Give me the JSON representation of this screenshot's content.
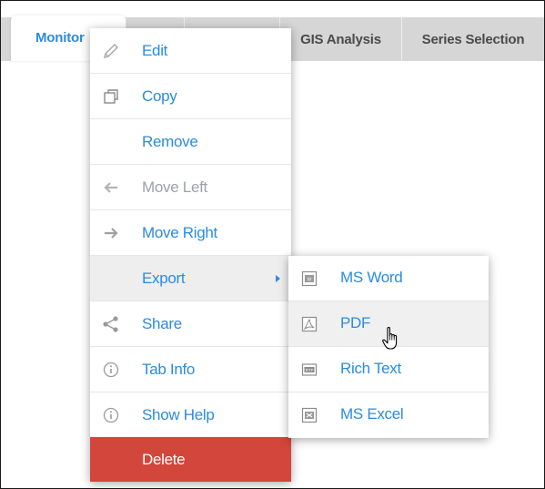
{
  "tabs": [
    {
      "label": "Monitor",
      "active": true
    },
    {
      "label": "",
      "active": false
    },
    {
      "label": "",
      "active": false
    },
    {
      "label": "GIS Analysis",
      "active": false
    },
    {
      "label": "Series Selection",
      "active": false
    }
  ],
  "context_menu": {
    "items": [
      {
        "label": "Edit",
        "icon": "pencil-icon",
        "state": "enabled"
      },
      {
        "label": "Copy",
        "icon": "copy-icon",
        "state": "enabled"
      },
      {
        "label": "Remove",
        "icon": "",
        "state": "enabled"
      },
      {
        "label": "Move Left",
        "icon": "arrow-left-icon",
        "state": "disabled"
      },
      {
        "label": "Move Right",
        "icon": "arrow-right-icon",
        "state": "enabled"
      },
      {
        "label": "Export",
        "icon": "",
        "state": "hover",
        "has_submenu": true
      },
      {
        "label": "Share",
        "icon": "share-icon",
        "state": "enabled"
      },
      {
        "label": "Tab Info",
        "icon": "info-icon",
        "state": "enabled"
      },
      {
        "label": "Show Help",
        "icon": "info-icon",
        "state": "enabled"
      },
      {
        "label": "Delete",
        "icon": "",
        "state": "danger"
      }
    ]
  },
  "export_submenu": {
    "items": [
      {
        "label": "MS Word",
        "icon": "word-doc-icon"
      },
      {
        "label": "PDF",
        "icon": "pdf-doc-icon",
        "state": "hover"
      },
      {
        "label": "Rich Text",
        "icon": "rtf-doc-icon"
      },
      {
        "label": "MS Excel",
        "icon": "excel-doc-icon"
      }
    ]
  },
  "colors": {
    "accent": "#2b8be0",
    "danger": "#d2463b",
    "tab_inactive": "#d6d6d6",
    "disabled_text": "#9aa3aa"
  }
}
